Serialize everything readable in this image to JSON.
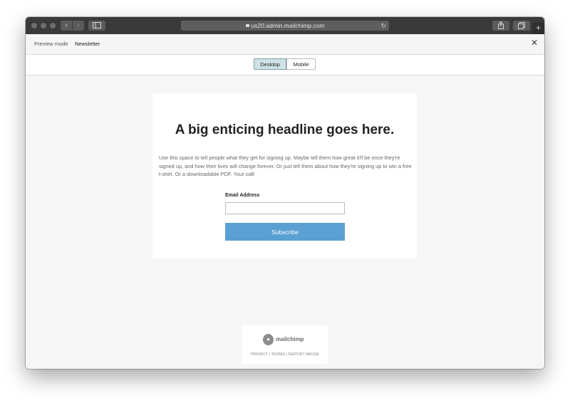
{
  "browser": {
    "url": "us20.admin.mailchimp.com",
    "back_glyph": "‹",
    "forward_glyph": "›",
    "reload_glyph": "↻",
    "plus_glyph": "+"
  },
  "preview_bar": {
    "mode_label": "Preview mode",
    "title": "Newsletter",
    "close_glyph": "✕"
  },
  "view_toggle": {
    "desktop_label": "Desktop",
    "mobile_label": "Mobile",
    "selected": "Desktop"
  },
  "signup_form": {
    "headline": "A big enticing headline goes here.",
    "intro": "Use this space to tell people what they get for signing up. Maybe tell them how great it'll be once they're signed up, and how their lives will change forever. Or just tell them about how they're signing up to win a free t-shirt. Or a downloadable PDF. Your call!",
    "email_label": "Email Address",
    "email_value": "",
    "subscribe_label": "Subscribe"
  },
  "footer": {
    "brand": "mailchimp",
    "links": [
      "PRIVACY",
      "TERMS",
      "REPORT ABUSE"
    ],
    "separator": " | "
  },
  "colors": {
    "subscribe_button": "#5aa0d2",
    "desktop_toggle_active": "#cfe2e6",
    "titlebar": "#3a3a3a",
    "canvas": "#f6f6f6"
  }
}
